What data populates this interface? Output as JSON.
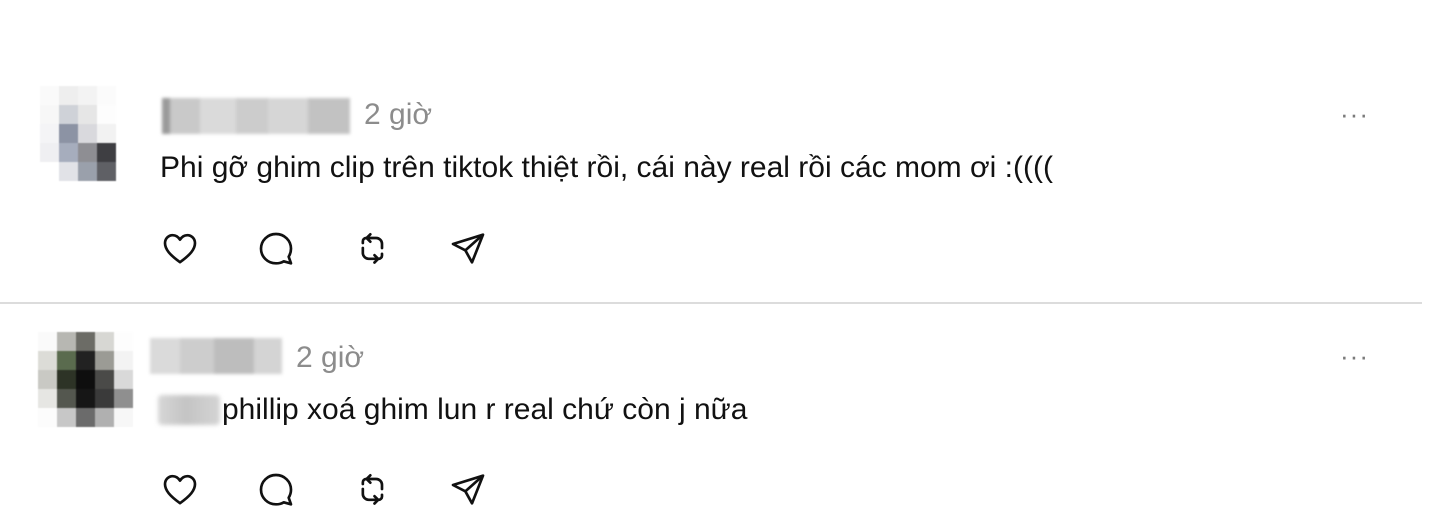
{
  "posts": [
    {
      "time": "2 giờ",
      "text": "Phi gỡ ghim clip trên tiktok thiệt rồi, cái này real rồi các mom ơi :((((",
      "more": "···"
    },
    {
      "time": "2 giờ",
      "text": "phillip xoá ghim lun r real chứ còn j nữa",
      "more": "···"
    }
  ],
  "actions": [
    "heart-icon",
    "comment-icon",
    "repost-icon",
    "share-icon"
  ],
  "colors": {
    "text": "#111111",
    "muted": "#8c8c8c",
    "divider": "#dcdcdc"
  }
}
